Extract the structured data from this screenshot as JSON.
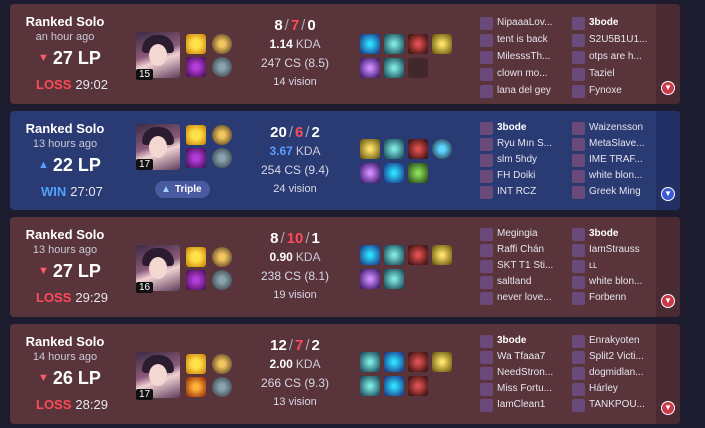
{
  "matches": [
    {
      "outcome": "loss",
      "queue": "Ranked Solo",
      "time_ago": "an hour ago",
      "lp": "27 LP",
      "result": "LOSS",
      "duration": "29:02",
      "champion_level": "15",
      "kills": "8",
      "deaths": "7",
      "assists": "0",
      "kda_ratio": "1.14",
      "kda_label": "KDA",
      "cs": "247 CS (8.5)",
      "vision": "14 vision",
      "blue_team": [
        "NipaaaLov...",
        "tent is back",
        "MilesssTh...",
        "clown mo...",
        "lana del gey"
      ],
      "red_team": [
        "3bode",
        "S2U5B1U1...",
        "otps are h...",
        "Taziel",
        "Fynoxe"
      ]
    },
    {
      "outcome": "win",
      "queue": "Ranked Solo",
      "time_ago": "13 hours ago",
      "lp": "22 LP",
      "result": "WIN",
      "duration": "27:07",
      "champion_level": "17",
      "multikill_tag": "Triple",
      "kills": "20",
      "deaths": "6",
      "assists": "2",
      "kda_ratio": "3.67",
      "kda_label": "KDA",
      "cs": "254 CS (9.4)",
      "vision": "24 vision",
      "blue_team": [
        "3bode",
        "Ryu Mın S...",
        "slm 5hdy",
        "FH Doiki",
        "INT RCZ"
      ],
      "red_team": [
        "Waizensson",
        "MetaSlave...",
        "IME TRAF...",
        "white blon...",
        "Greek Ming"
      ]
    },
    {
      "outcome": "loss",
      "queue": "Ranked Solo",
      "time_ago": "13 hours ago",
      "lp": "27 LP",
      "result": "LOSS",
      "duration": "29:29",
      "champion_level": "16",
      "kills": "8",
      "deaths": "10",
      "assists": "1",
      "kda_ratio": "0.90",
      "kda_label": "KDA",
      "cs": "238 CS (8.1)",
      "vision": "19 vision",
      "blue_team": [
        "Megingia",
        "Raffi Chán",
        "SKT T1 Sti...",
        "saltland",
        "never love..."
      ],
      "red_team": [
        "3bode",
        "IamStrauss",
        "ʟʟ",
        "white blon...",
        "Forbenn"
      ]
    },
    {
      "outcome": "loss",
      "queue": "Ranked Solo",
      "time_ago": "14 hours ago",
      "lp": "26 LP",
      "result": "LOSS",
      "duration": "28:29",
      "champion_level": "17",
      "kills": "12",
      "deaths": "7",
      "assists": "2",
      "kda_ratio": "2.00",
      "kda_label": "KDA",
      "cs": "266 CS (9.3)",
      "vision": "13 vision",
      "blue_team": [
        "3bode",
        "Wa Tfaaa7",
        "NeedStron...",
        "Miss Fortu...",
        "IamClean1"
      ],
      "red_team": [
        "Enrakyoten",
        "Split2 Victi...",
        "dogmidlan...",
        "Hárley",
        "TANKPOU..."
      ]
    }
  ],
  "icons": {
    "lp_down": "▼",
    "lp_up": "▲",
    "expand": "chevron-down-icon",
    "multikill": "triangle-icon"
  },
  "colors": {
    "loss_bg": "#59343b",
    "win_bg": "#2a3a72",
    "loss_accent": "#ff4a5a",
    "win_accent": "#4fa0ff"
  }
}
